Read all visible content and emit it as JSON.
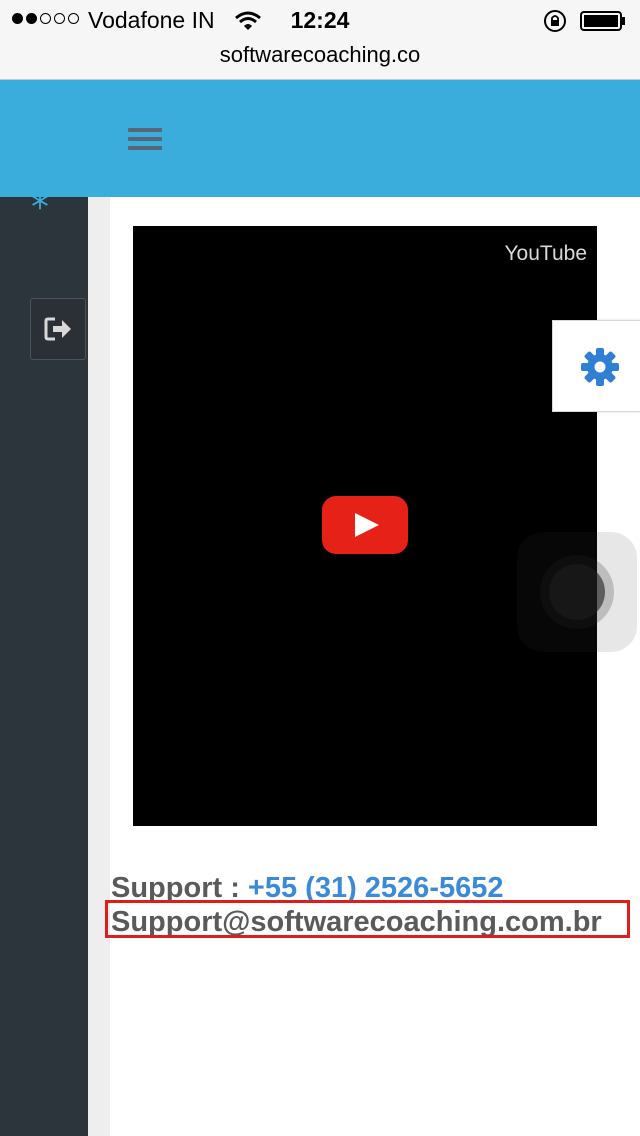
{
  "status_bar": {
    "signal_dots_filled": 2,
    "signal_dots_total": 5,
    "carrier": "Vodafone IN",
    "time": "12:24",
    "icons": [
      "wifi-icon",
      "rotation-lock-icon",
      "battery-icon"
    ]
  },
  "url_bar": {
    "domain": "softwarecoaching.co"
  },
  "header": {
    "menu_icon": "hamburger-menu-icon",
    "color": "#3aaddc"
  },
  "sidebar": {
    "icons": [
      "snowflake-icon",
      "logout-icon"
    ],
    "color": "#2c343c"
  },
  "video": {
    "provider_label": "YouTube",
    "play_icon": "play-icon"
  },
  "floating": {
    "settings_icon": "gear-icon",
    "assistive_touch": "assistive-touch-button"
  },
  "support": {
    "phone_label": "Support : ",
    "phone_number": "+55 (31) 2526-5652",
    "email": "Support@softwarecoaching.com.br"
  },
  "colors": {
    "accent_blue": "#3b8ad9",
    "gear_blue": "#2f7fd4",
    "highlight_red": "#e01d1d",
    "youtube_red": "#e62117"
  }
}
